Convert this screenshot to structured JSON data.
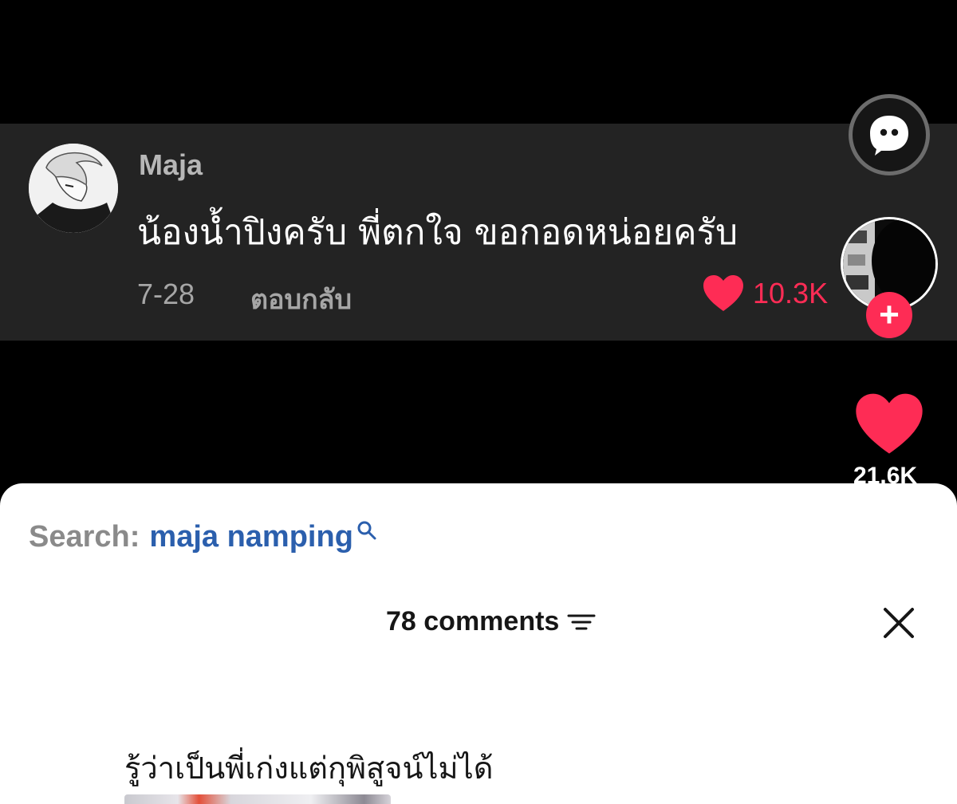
{
  "overlay_comment": {
    "username": "Maja",
    "text": "น้องน้ำปิงครับ พี่ตกใจ ขอกอดหน่อยครับ",
    "date": "7-28",
    "reply_label": "ตอบกลับ",
    "like_count": "10.3K"
  },
  "side_actions": {
    "like_count": "21.6K",
    "follow_label": "+"
  },
  "sheet": {
    "search_prefix": "Search:",
    "search_term": "maja namping",
    "comments_count": "78 comments",
    "first_comment": "รู้ว่าเป็นพี่เก่งแต่กุพิสูจน์ไม่ได้"
  },
  "colors": {
    "accent_red": "#fe2c55",
    "search_blue": "#2b5fad"
  },
  "icons": [
    "chat-bubble-icon",
    "heart-icon",
    "search-icon",
    "sort-icon",
    "close-icon"
  ]
}
